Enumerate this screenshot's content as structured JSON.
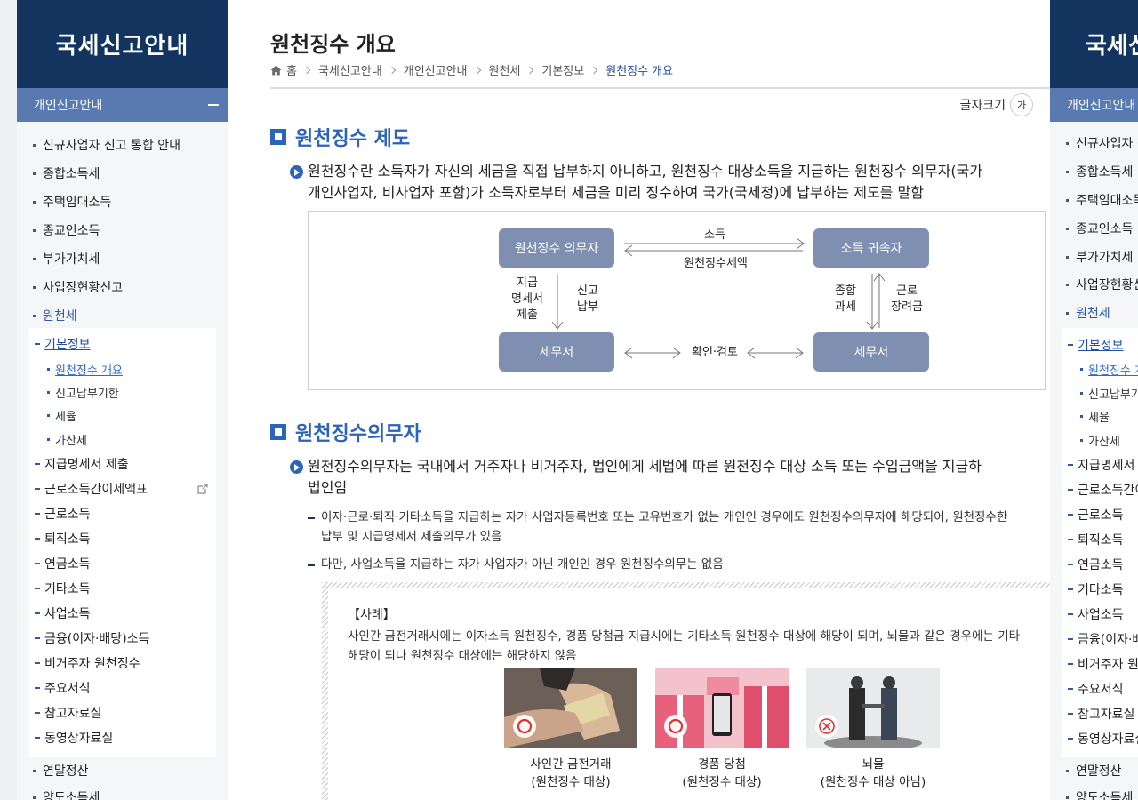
{
  "sidebar": {
    "title": "국세신고안내",
    "section": "개인신고안내",
    "items": [
      "신규사업자 신고 통합 안내",
      "종합소득세",
      "주택임대소득",
      "종교인소득",
      "부가가치세",
      "사업장현황신고",
      "원천세"
    ],
    "sub_items": [
      {
        "label": "기본정보",
        "level": 1,
        "current": true
      },
      {
        "label": "원천징수 개요",
        "level": 2,
        "current": true
      },
      {
        "label": "신고납부기한",
        "level": 2
      },
      {
        "label": "세율",
        "level": 2
      },
      {
        "label": "가산세",
        "level": 2
      },
      {
        "label": "지급명세서 제출",
        "level": 1
      },
      {
        "label": "근로소득간이세액표",
        "level": 1,
        "external": true
      },
      {
        "label": "근로소득",
        "level": 1
      },
      {
        "label": "퇴직소득",
        "level": 1
      },
      {
        "label": "연금소득",
        "level": 1
      },
      {
        "label": "기타소득",
        "level": 1
      },
      {
        "label": "사업소득",
        "level": 1
      },
      {
        "label": "금융(이자·배당)소득",
        "level": 1
      },
      {
        "label": "비거주자 원천징수",
        "level": 1
      },
      {
        "label": "주요서식",
        "level": 1
      },
      {
        "label": "참고자료실",
        "level": 1
      },
      {
        "label": "동영상자료실",
        "level": 1
      }
    ],
    "bottom_items": [
      "연말정산",
      "양도소득세"
    ]
  },
  "header": {
    "page_title": "원천징수 개요",
    "breadcrumb": [
      "홈",
      "국세신고안내",
      "개인신고안내",
      "원천세",
      "기본정보",
      "원천징수 개요"
    ],
    "font_size_label": "글자크기",
    "font_size_button": "가"
  },
  "section1": {
    "heading": "원천징수 제도",
    "para_line1": "원천징수란 소득자가 자신의 세금을 직접 납부하지 아니하고, 원천징수 대상소득을 지급하는 원천징수 의무자(국가",
    "para_line2": "개인사업자, 비사업자 포함)가 소득자로부터 세금을 미리 징수하여 국가(국세청)에 납부하는 제도를 말함",
    "diagram": {
      "box_withholder": "원천징수 의무자",
      "box_earner": "소득 귀속자",
      "box_tax_office_left": "세무서",
      "box_tax_office_right": "세무서",
      "arrow_income": "소득",
      "arrow_withheld": "원천징수세액",
      "left_down_1": "지급",
      "left_down_2": "명세서",
      "left_down_3": "제출",
      "left_up_1": "신고",
      "left_up_2": "납부",
      "right_1": "종합",
      "right_2": "과세",
      "right_3": "근로",
      "right_4": "장려금",
      "bottom_label": "확인·검토"
    }
  },
  "section2": {
    "heading": "원천징수의무자",
    "para_line1": "원천징수의무자는 국내에서 거주자나 비거주자, 법인에게 세법에 따른 원천징수 대상 소득 또는 수입금액을 지급하",
    "para_line2": "법인임",
    "note1_line1": "이자·근로·퇴직·기타소득을 지급하는 자가 사업자등록번호 또는 고유번호가 없는 개인인 경우에도 원천징수의무자에 해당되어, 원천징수한",
    "note1_line2": "납부 및 지급명세서 제출의무가 있음",
    "note2": "다만, 사업소득을 지급하는 자가 사업자가 아닌 개인인 경우 원천징수의무는 없음",
    "example": {
      "title": "【사례】",
      "body_line1": "사인간 금전거래시에는 이자소득 원천징수, 경품 당첨금 지급시에는 기타소득 원천징수 대상에 해당이 되며, 뇌물과 같은 경우에는 기타",
      "body_line2": "해당이 되나 원천징수 대상에는 해당하지 않음",
      "cases": [
        {
          "title": "사인간 금전거래",
          "note": "(원천징수 대상)",
          "mark": "circle"
        },
        {
          "title": "경품 당첨",
          "note": "(원천징수 대상)",
          "mark": "circle"
        },
        {
          "title": "뇌물",
          "note": "(원천징수 대상 아님)",
          "mark": "x"
        }
      ]
    }
  },
  "right_panel": {
    "title": "국세신고안내",
    "section": "개인신고안내",
    "items": [
      "신규사업자 신고 통합 안내",
      "종합소득세",
      "주택임대소득",
      "종교인소득",
      "부가가치세",
      "사업장현황신고",
      "원천세"
    ],
    "sub_items": [
      "기본정보",
      "원천징수 개요",
      "신고납부기한",
      "세율",
      "가산세",
      "지급명세서 제출",
      "근로소득간이세액표",
      "근로소득",
      "퇴직소득",
      "연금소득",
      "기타소득",
      "사업소득",
      "금융(이자·배당)소득",
      "비거주자 원천징수",
      "주요서식",
      "참고자료실",
      "동영상자료실"
    ],
    "bottom_items": [
      "연말정산",
      "양도소득세"
    ]
  },
  "colors": {
    "navy": "#12345f",
    "section_blue": "#587ab0",
    "accent_blue": "#2b64b8",
    "diagram_box": "#7e8fb2"
  }
}
